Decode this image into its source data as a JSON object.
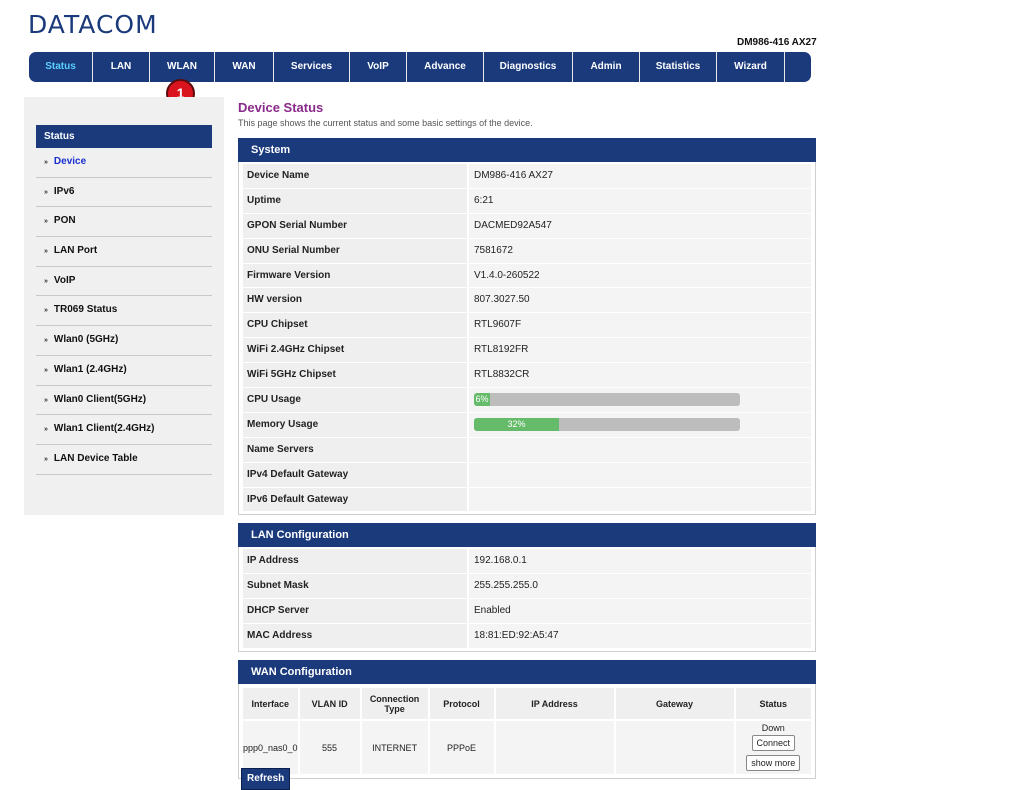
{
  "brand": {
    "logo": "DATACOM",
    "model": "DM986-416 AX27"
  },
  "nav": [
    {
      "label": "Status",
      "width": 64
    },
    {
      "label": "LAN",
      "width": 57
    },
    {
      "label": "WLAN",
      "width": 65
    },
    {
      "label": "WAN",
      "width": 59
    },
    {
      "label": "Services",
      "width": 76
    },
    {
      "label": "VoIP",
      "width": 57
    },
    {
      "label": "Advance",
      "width": 77
    },
    {
      "label": "Diagnostics",
      "width": 89
    },
    {
      "label": "Admin",
      "width": 67
    },
    {
      "label": "Statistics",
      "width": 77
    },
    {
      "label": "Wizard",
      "width": 68
    }
  ],
  "badge": "1",
  "sidebar": {
    "heading": "Status",
    "items": [
      "Device",
      "IPv6",
      "PON",
      "LAN Port",
      "VoIP",
      "TR069 Status",
      "Wlan0 (5GHz)",
      "Wlan1 (2.4GHz)",
      "Wlan0 Client(5GHz)",
      "Wlan1 Client(2.4GHz)",
      "LAN Device Table"
    ],
    "active_index": 0
  },
  "page": {
    "title": "Device Status",
    "description": "This page shows the current status and some basic settings of the device."
  },
  "system": {
    "heading": "System",
    "rows": [
      {
        "k": "Device Name",
        "v": "DM986-416 AX27"
      },
      {
        "k": "Uptime",
        "v": "6:21"
      },
      {
        "k": "GPON Serial Number",
        "v": "DACMED92A547"
      },
      {
        "k": "ONU Serial Number",
        "v": "7581672"
      },
      {
        "k": "Firmware Version",
        "v": "V1.4.0-260522"
      },
      {
        "k": "HW version",
        "v": "807.3027.50"
      },
      {
        "k": "CPU Chipset",
        "v": "RTL9607F"
      },
      {
        "k": "WiFi 2.4GHz Chipset",
        "v": "RTL8192FR"
      },
      {
        "k": "WiFi 5GHz Chipset",
        "v": "RTL8832CR"
      },
      {
        "k": "CPU Usage",
        "bar": 6,
        "bar_label": "6%"
      },
      {
        "k": "Memory Usage",
        "bar": 32,
        "bar_label": "32%"
      },
      {
        "k": "Name Servers",
        "v": ""
      },
      {
        "k": "IPv4 Default Gateway",
        "v": ""
      },
      {
        "k": "IPv6 Default Gateway",
        "v": ""
      }
    ]
  },
  "lan": {
    "heading": "LAN Configuration",
    "rows": [
      {
        "k": "IP Address",
        "v": "192.168.0.1"
      },
      {
        "k": "Subnet Mask",
        "v": "255.255.255.0"
      },
      {
        "k": "DHCP Server",
        "v": "Enabled"
      },
      {
        "k": "MAC Address",
        "v": "18:81:ED:92:A5:47"
      }
    ]
  },
  "wan": {
    "heading": "WAN Configuration",
    "columns": [
      "Interface",
      "VLAN ID",
      "Connection Type",
      "Protocol",
      "IP Address",
      "Gateway",
      "Status"
    ],
    "row": {
      "interface": "ppp0_nas0_0",
      "vlan": "555",
      "type": "INTERNET",
      "protocol": "PPPoE",
      "ip": "",
      "gateway": "",
      "status": "Down",
      "connect_label": "Connect",
      "more_label": "show more"
    }
  },
  "refresh_label": "Refresh",
  "colors": {
    "primary": "#1a3a7c",
    "accent_title": "#8a2a8a",
    "bar_fill": "#66bb6a",
    "badge": "#d9141f"
  }
}
